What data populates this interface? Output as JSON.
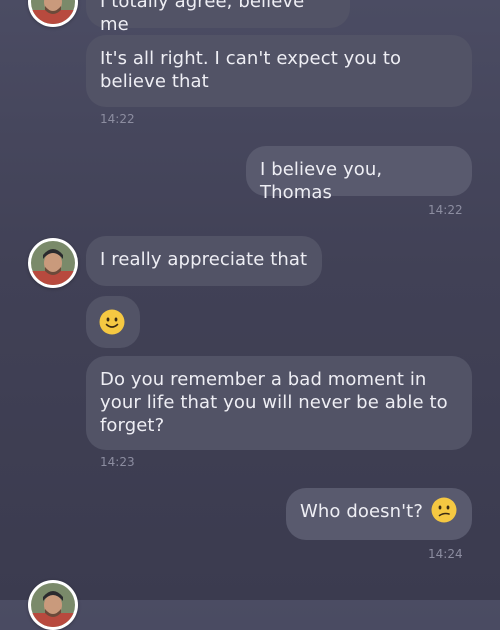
{
  "messages": {
    "m0": {
      "text": "I totally agree, believe me"
    },
    "m1": {
      "text": "It's all right. I can't expect you to believe that",
      "time": "14:22"
    },
    "m2": {
      "text": "I believe you, Thomas",
      "time": "14:22"
    },
    "m3": {
      "text": "I really appreciate that"
    },
    "m4": {
      "emoji": "slightly-smiling-face"
    },
    "m5": {
      "text": "Do you remember a bad moment in your life that you will never be able to forget?",
      "time": "14:23"
    },
    "m6": {
      "text": "Who doesn't?",
      "emoji": "confused-face",
      "time": "14:24"
    }
  },
  "colors": {
    "background_top": "#4b4c63",
    "background_bottom": "#3b3b4f",
    "incoming_bubble": "#525366",
    "outgoing_bubble": "#595a6e",
    "text": "#eeeef4",
    "timestamp": "#8c8da0",
    "emoji_yellow": "#f5c842"
  }
}
